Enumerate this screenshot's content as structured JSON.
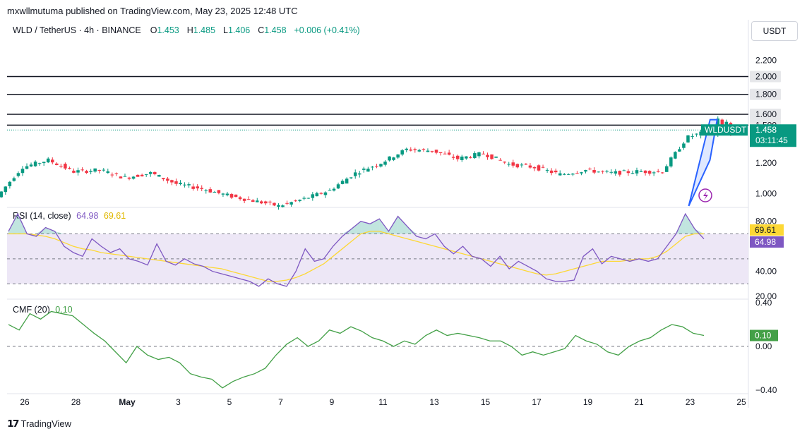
{
  "header": {
    "published": "mxwllmutuma published on TradingView.com, May 23, 2025 12:48 UTC"
  },
  "legend": {
    "symbol": "WLD / TetherUS · 4h · BINANCE",
    "o_label": "O",
    "o_value": "1.453",
    "h_label": "H",
    "h_value": "1.485",
    "l_label": "L",
    "l_value": "1.406",
    "c_label": "C",
    "c_value": "1.458",
    "change": "+0.006 (+0.41%)"
  },
  "currency": "USDT",
  "footer": {
    "brand": "TradingView"
  },
  "colors": {
    "up": "#089981",
    "down": "#f23645",
    "rsi": "#7e57c2",
    "rsi_ma": "#fdd835",
    "rsi_band": "#ede7f6",
    "cmf": "#43a047",
    "level_line": "#131722",
    "channel": "#2962ff"
  },
  "chart_data": [
    {
      "type": "candlestick",
      "title": "WLD / TetherUS · 4h · BINANCE",
      "y_scale": "log",
      "ylim": [
        0.93,
        2.5
      ],
      "y_ticks": [
        "2.200",
        "1.200",
        "1.000"
      ],
      "x_ticks": [
        "26",
        "28",
        "May",
        "3",
        "5",
        "7",
        "9",
        "11",
        "13",
        "15",
        "17",
        "19",
        "21",
        "23",
        "25"
      ],
      "horizontal_levels": [
        {
          "value": 2.0,
          "label": "2.000"
        },
        {
          "value": 1.8,
          "label": "1.800"
        },
        {
          "value": 1.6,
          "label": "1.600"
        },
        {
          "value": 1.5,
          "label": "1.500"
        }
      ],
      "last_price": {
        "symbol": "WLDUSDT",
        "value": "1.458",
        "countdown": "03:11:45"
      },
      "close_path_keypoints": [
        {
          "date": "Apr 25",
          "close": 0.98
        },
        {
          "date": "Apr 26",
          "close": 1.17
        },
        {
          "date": "Apr 27",
          "close": 1.22
        },
        {
          "date": "Apr 28",
          "close": 1.14
        },
        {
          "date": "Apr 29",
          "close": 1.15
        },
        {
          "date": "Apr 30",
          "close": 1.1
        },
        {
          "date": "May 1",
          "close": 1.13
        },
        {
          "date": "May 2",
          "close": 1.06
        },
        {
          "date": "May 3",
          "close": 1.03
        },
        {
          "date": "May 4",
          "close": 0.99
        },
        {
          "date": "May 5",
          "close": 0.96
        },
        {
          "date": "May 6",
          "close": 0.93
        },
        {
          "date": "May 7",
          "close": 0.97
        },
        {
          "date": "May 8",
          "close": 1.02
        },
        {
          "date": "May 9",
          "close": 1.13
        },
        {
          "date": "May 10",
          "close": 1.2
        },
        {
          "date": "May 11",
          "close": 1.3
        },
        {
          "date": "May 12",
          "close": 1.29
        },
        {
          "date": "May 13",
          "close": 1.23
        },
        {
          "date": "May 14",
          "close": 1.27
        },
        {
          "date": "May 15",
          "close": 1.19
        },
        {
          "date": "May 16",
          "close": 1.17
        },
        {
          "date": "May 17",
          "close": 1.12
        },
        {
          "date": "May 18",
          "close": 1.15
        },
        {
          "date": "May 19",
          "close": 1.13
        },
        {
          "date": "May 20",
          "close": 1.14
        },
        {
          "date": "May 21",
          "close": 1.14
        },
        {
          "date": "May 22",
          "close": 1.4
        },
        {
          "date": "May 23",
          "close": 1.458
        }
      ],
      "channel": {
        "from": {
          "date": "May 21",
          "price": 0.93
        },
        "to": {
          "date": "May 22",
          "price": 1.55
        }
      }
    },
    {
      "type": "line",
      "title": "RSI (14, close)",
      "legend_values": [
        "64.98",
        "69.61"
      ],
      "ylim": [
        20,
        90
      ],
      "y_ticks": [
        "80.00",
        "40.00",
        "20.00"
      ],
      "bands": [
        70,
        50,
        30
      ],
      "last_values": [
        {
          "name": "RSI MA",
          "value": "69.61"
        },
        {
          "name": "RSI",
          "value": "64.98"
        }
      ],
      "series": [
        {
          "name": "RSI",
          "values": [
            72,
            86,
            70,
            68,
            75,
            72,
            60,
            55,
            52,
            66,
            60,
            55,
            58,
            50,
            48,
            45,
            62,
            48,
            45,
            50,
            46,
            44,
            40,
            38,
            36,
            34,
            32,
            28,
            34,
            30,
            28,
            40,
            58,
            48,
            50,
            60,
            68,
            74,
            80,
            78,
            82,
            72,
            84,
            76,
            68,
            66,
            70,
            60,
            54,
            60,
            52,
            50,
            44,
            52,
            42,
            48,
            44,
            40,
            34,
            32,
            32,
            33,
            52,
            58,
            46,
            52,
            50,
            48,
            50,
            48,
            50,
            60,
            70,
            86,
            74,
            66
          ]
        },
        {
          "name": "RSI MA",
          "values": [
            70,
            70,
            70,
            69,
            68,
            66,
            63,
            60,
            58,
            57,
            55,
            54,
            53,
            52,
            51,
            50,
            49,
            48,
            47,
            46,
            45,
            44,
            43,
            42,
            40,
            38,
            36,
            34,
            32,
            32,
            33,
            35,
            38,
            42,
            46,
            52,
            58,
            64,
            70,
            72,
            72,
            70,
            68,
            66,
            64,
            62,
            60,
            58,
            56,
            54,
            52,
            50,
            48,
            46,
            44,
            42,
            40,
            38,
            37,
            38,
            40,
            42,
            44,
            46,
            48,
            48,
            48,
            49,
            50,
            50,
            52,
            56,
            62,
            68,
            70,
            70
          ]
        }
      ]
    },
    {
      "type": "line",
      "title": "CMF (20)",
      "legend_values": [
        "0.10"
      ],
      "ylim": [
        -0.42,
        0.42
      ],
      "y_ticks": [
        "0.40",
        "0.00",
        "−0.40"
      ],
      "zero_line": 0,
      "last_values": [
        {
          "name": "CMF",
          "value": "0.10"
        }
      ],
      "series": [
        {
          "name": "CMF",
          "values": [
            0.2,
            0.15,
            0.3,
            0.25,
            0.32,
            0.3,
            0.28,
            0.2,
            0.12,
            0.05,
            -0.05,
            -0.15,
            0.0,
            -0.08,
            -0.12,
            -0.1,
            -0.15,
            -0.25,
            -0.28,
            -0.3,
            -0.38,
            -0.32,
            -0.28,
            -0.25,
            -0.2,
            -0.08,
            0.02,
            0.08,
            0.0,
            0.05,
            0.15,
            0.12,
            0.18,
            0.14,
            0.08,
            0.05,
            0.0,
            0.05,
            0.02,
            0.1,
            0.15,
            0.1,
            0.12,
            0.1,
            0.08,
            0.05,
            0.05,
            0.0,
            -0.08,
            -0.05,
            -0.08,
            -0.05,
            -0.02,
            0.1,
            0.05,
            0.02,
            -0.05,
            -0.08,
            0.0,
            0.05,
            0.08,
            0.15,
            0.2,
            0.18,
            0.12,
            0.1
          ]
        }
      ]
    }
  ]
}
